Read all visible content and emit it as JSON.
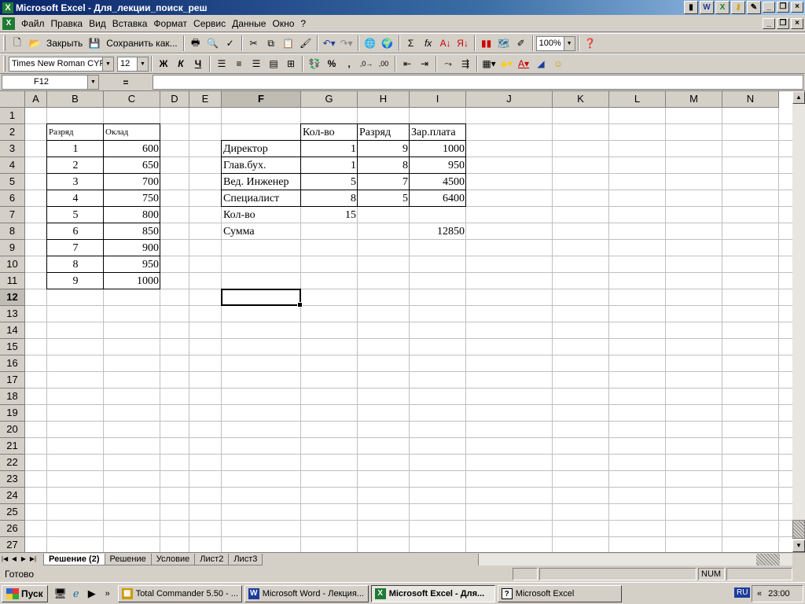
{
  "window": {
    "title": "Microsoft Excel - Для_лекции_поиск_реш",
    "app_icon": "X"
  },
  "menu": [
    "Файл",
    "Правка",
    "Вид",
    "Вставка",
    "Формат",
    "Сервис",
    "Данные",
    "Окно",
    "?"
  ],
  "toolbar1": {
    "close_label": "Закрыть",
    "save_as_label": "Сохранить как...",
    "sum": "Σ",
    "fx": "fx",
    "zoom": "100%"
  },
  "toolbar2": {
    "font": "Times New Roman CYR",
    "size": "12",
    "bold": "Ж",
    "italic": "К",
    "underline": "Ч",
    "percent": "%",
    "comma": ","
  },
  "formula_bar": {
    "name_box": "F12",
    "eq": "="
  },
  "grid": {
    "columns": [
      "A",
      "B",
      "C",
      "D",
      "E",
      "F",
      "G",
      "H",
      "I",
      "J",
      "K",
      "L",
      "M",
      "N"
    ],
    "rows": [
      "1",
      "2",
      "3",
      "4",
      "5",
      "6",
      "7",
      "8",
      "9",
      "10",
      "11",
      "12",
      "13",
      "14",
      "15",
      "16",
      "17",
      "18",
      "19",
      "20",
      "21",
      "22",
      "23",
      "24",
      "25",
      "26",
      "27"
    ],
    "selected_row": "12",
    "selected_col": "F"
  },
  "table_left": {
    "headers": [
      "Разряд",
      "Оклад"
    ],
    "rows": [
      [
        "1",
        "600"
      ],
      [
        "2",
        "650"
      ],
      [
        "3",
        "700"
      ],
      [
        "4",
        "750"
      ],
      [
        "5",
        "800"
      ],
      [
        "6",
        "850"
      ],
      [
        "7",
        "900"
      ],
      [
        "8",
        "950"
      ],
      [
        "9",
        "1000"
      ]
    ]
  },
  "table_right": {
    "headers": [
      "Кол-во",
      "Разряд",
      "Зар.плата"
    ],
    "rows": [
      [
        "Директор",
        "1",
        "9",
        "1000"
      ],
      [
        "Глав.бух.",
        "1",
        "8",
        "950"
      ],
      [
        "Вед. Инженер",
        "5",
        "7",
        "4500"
      ],
      [
        "Специалист",
        "8",
        "5",
        "6400"
      ]
    ],
    "count_label": "Кол-во",
    "count_value": "15",
    "sum_label": "Сумма",
    "sum_value": "12850"
  },
  "sheets": [
    "Решение (2)",
    "Решение",
    "Условие",
    "Лист2",
    "Лист3"
  ],
  "status": {
    "text": "Готово",
    "num": "NUM"
  },
  "taskbar": {
    "start": "Пуск",
    "tasks": [
      "Total Commander 5.50 - ...",
      "Microsoft Word - Лекция...",
      "Microsoft Excel - Для...",
      "Microsoft Excel"
    ],
    "lang": "RU",
    "time": "23:00"
  }
}
